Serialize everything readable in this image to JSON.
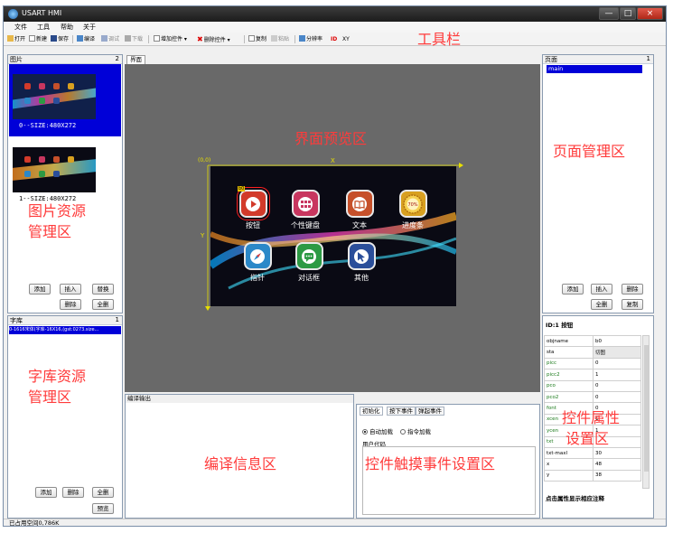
{
  "window": {
    "title": "USART HMI",
    "minimize": "—",
    "maximize": "□",
    "close": "×"
  },
  "menu": {
    "file": "文件",
    "tools": "工具",
    "help": "帮助",
    "about": "关于"
  },
  "toolbar": {
    "open": "打开",
    "new": "新建",
    "save": "保存",
    "compile": "编译",
    "debug": "调试",
    "download": "下载",
    "add_control": "增加控件 ▾",
    "delete_control": "删除控件 ▾",
    "copy": "复制",
    "paste": "粘贴",
    "resolution": "分辨率",
    "id": "ID",
    "xy": "XY"
  },
  "picture_panel": {
    "title": "图片",
    "count": "2",
    "items": [
      {
        "label": "0--SIZE:480X272"
      },
      {
        "label": "1--SIZE:480X272"
      }
    ],
    "buttons": {
      "add": "添加",
      "insert": "插入",
      "replace": "替换",
      "delete": "删除",
      "delete_all": "全删"
    }
  },
  "font_panel": {
    "title": "字库",
    "count": "1",
    "items": [
      {
        "label": "0-1616宋体(字库-16X16,(gst:0273.size..."
      }
    ],
    "buttons": {
      "add": "添加",
      "delete": "删除",
      "delete_all": "全删",
      "preview": "预览"
    }
  },
  "preview_area": {
    "tab": "界面",
    "origin": "(0,0)",
    "x_label": "X",
    "y_label": "Y",
    "selected_id": "b0",
    "items": [
      {
        "label": "按钮",
        "icon": "play-icon",
        "color": "#d23a2a"
      },
      {
        "label": "个性键盘",
        "icon": "keyboard-grid-icon",
        "color": "#c8365f"
      },
      {
        "label": "文本",
        "icon": "book-icon",
        "color": "#c6502a"
      },
      {
        "label": "进度条",
        "icon": "progress-badge-icon",
        "color": "#d8a020"
      },
      {
        "label": "指针",
        "icon": "compass-icon",
        "color": "#2b88c8"
      },
      {
        "label": "对话框",
        "icon": "chat-icon",
        "color": "#2d9a44"
      },
      {
        "label": "其他",
        "icon": "cursor-arrow-icon",
        "color": "#2a4e9a"
      }
    ],
    "badge_text": "70%"
  },
  "page_panel": {
    "title": "页面",
    "count": "1",
    "items": [
      {
        "label": "main"
      }
    ],
    "buttons": {
      "add": "添加",
      "insert": "插入",
      "delete": "删除",
      "delete_all": "全删",
      "copy": "复制"
    }
  },
  "compile_panel": {
    "title": "编译输出"
  },
  "event_panel": {
    "tabs": [
      "初始化",
      "按下事件",
      "弹起事件"
    ],
    "auto_load": "自动加载",
    "cmd_load": "指令加载",
    "user_code": "用户代码"
  },
  "attr_panel": {
    "header": "ID:1 按钮",
    "rows": [
      {
        "k": "objname",
        "v": "b0"
      },
      {
        "k": "sta",
        "v": "切图"
      },
      {
        "k": "picc",
        "v": "0"
      },
      {
        "k": "picc2",
        "v": "1"
      },
      {
        "k": "pco",
        "v": "0"
      },
      {
        "k": "pco2",
        "v": "0"
      },
      {
        "k": "font",
        "v": "0"
      },
      {
        "k": "xcen",
        "v": "1"
      },
      {
        "k": "ycen",
        "v": "1"
      },
      {
        "k": "txt",
        "v": ""
      },
      {
        "k": "txt-maxl",
        "v": "30"
      },
      {
        "k": "x",
        "v": "48"
      },
      {
        "k": "y",
        "v": "38"
      }
    ],
    "hint": "点击属性显示相应注释"
  },
  "status_bar": {
    "text": "已占用空间0,786K"
  },
  "annotations": {
    "toolbar": "工具栏",
    "preview": "界面预览区",
    "page_mgr": "页面管理区",
    "pic_line1": "图片资源",
    "pic_line2": "管理区",
    "font_line1": "字库资源",
    "font_line2": "管理区",
    "compile": "编译信息区",
    "event": "控件触摸事件设置区",
    "attr_line1": "控件属性",
    "attr_line2": "设置区"
  },
  "colors": {
    "accent": "#0000d8",
    "annotation": "#ff3b3b",
    "preview_bg": "#696969",
    "selected_row": "#0000d8"
  }
}
